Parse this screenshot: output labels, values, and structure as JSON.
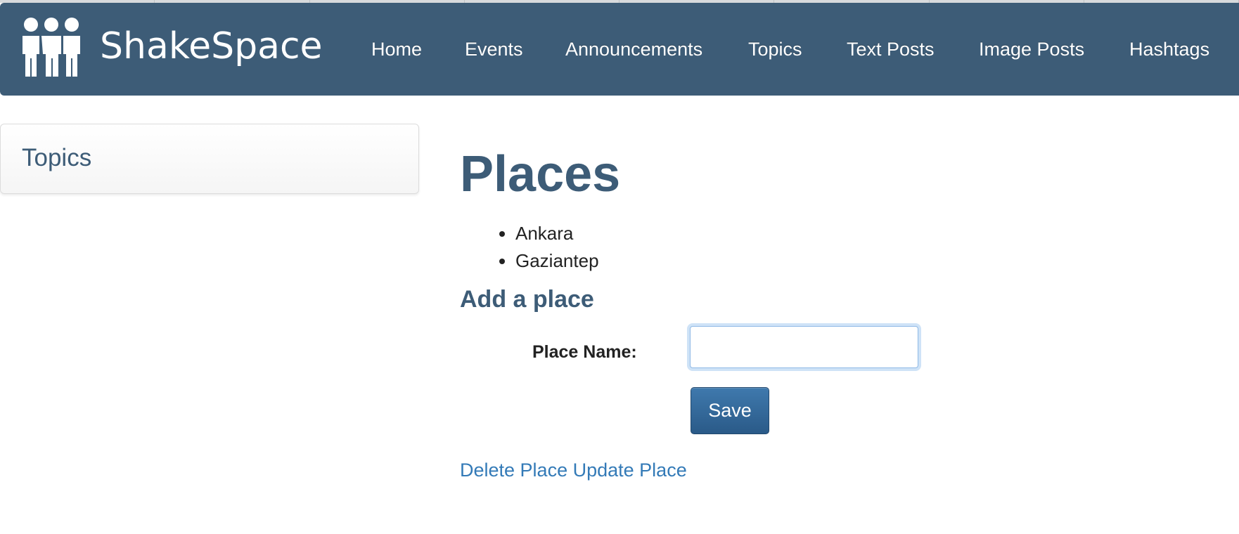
{
  "app": {
    "brand_name": "ShakeSpace",
    "logo_icon": "people-group-icon"
  },
  "navbar": {
    "background": "#3d5c77",
    "items": [
      {
        "label": "Home"
      },
      {
        "label": "Events"
      },
      {
        "label": "Announcements"
      },
      {
        "label": "Topics"
      },
      {
        "label": "Text Posts"
      },
      {
        "label": "Image Posts"
      },
      {
        "label": "Hashtags"
      }
    ]
  },
  "sidebar": {
    "title": "Topics"
  },
  "main": {
    "title": "Places",
    "places": [
      "Ankara",
      "Gaziantep"
    ],
    "add_section_title": "Add a place",
    "form": {
      "place_name_label": "Place Name:",
      "place_name_value": "",
      "save_label": "Save"
    },
    "links": {
      "delete_label": "Delete Place",
      "update_label": "Update Place"
    }
  },
  "colors": {
    "accent": "#3d5c77",
    "link": "#337ab7",
    "button": "#2f6496"
  }
}
